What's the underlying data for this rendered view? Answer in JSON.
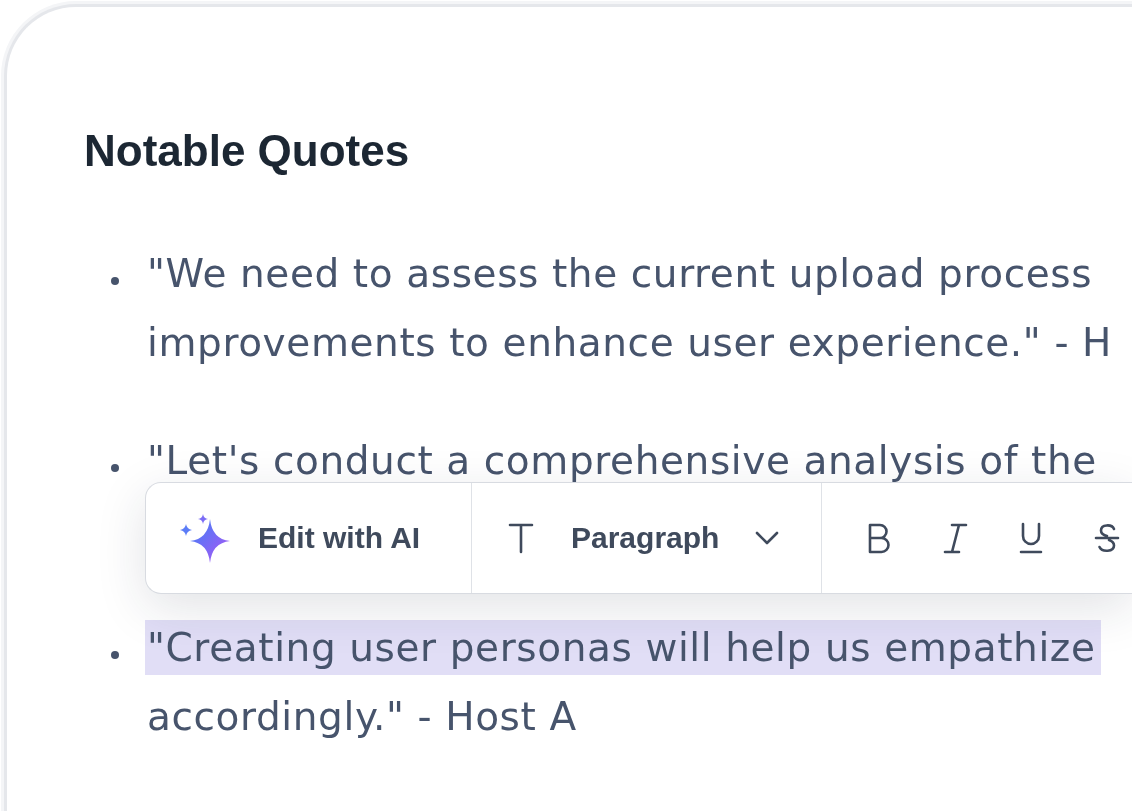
{
  "heading": "Notable Quotes",
  "quotes": [
    {
      "lines": [
        {
          "text": "\"We need to assess the current upload process",
          "selected": false
        },
        {
          "text": "improvements to enhance user experience.\" - H",
          "selected": false
        }
      ]
    },
    {
      "lines": [
        {
          "text": "\"Let's conduct a comprehensive analysis of the",
          "selected": false
        }
      ]
    },
    {
      "lines": [
        {
          "text": "\"Creating user personas will help us empathize",
          "selected": true
        },
        {
          "text": "accordingly.\" - Host A",
          "selected": false
        }
      ]
    }
  ],
  "toolbar": {
    "ai_button": {
      "label": "Edit with AI"
    },
    "block_style": {
      "label": "Paragraph"
    }
  }
}
